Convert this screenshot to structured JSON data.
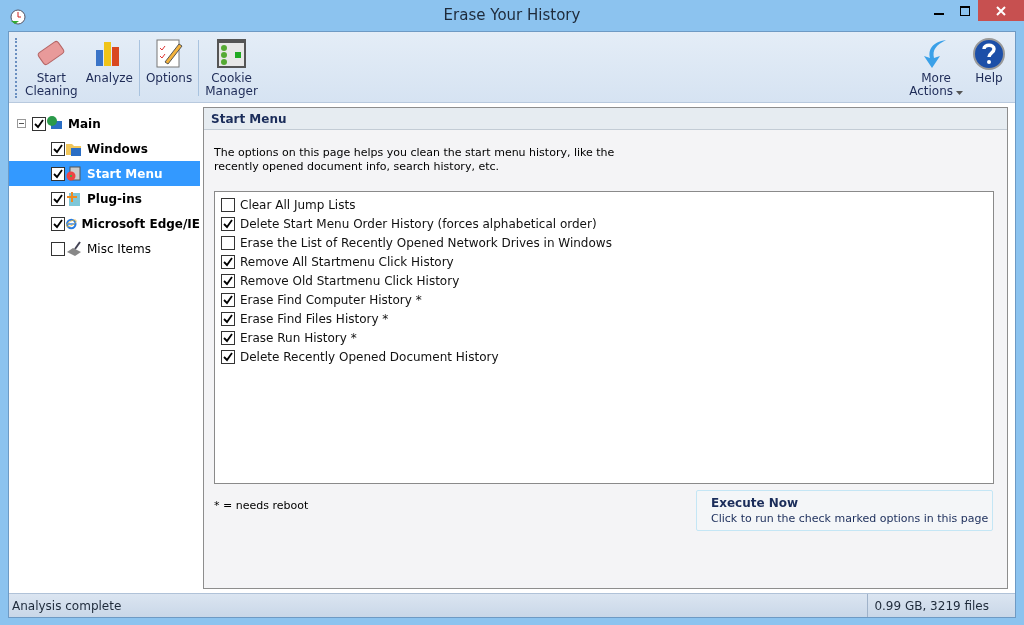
{
  "window": {
    "title": "Erase Your History"
  },
  "toolbar": {
    "groups": [
      [
        {
          "label": "Start\nCleaning"
        },
        {
          "label": "Analyze"
        }
      ],
      [
        {
          "label": "Options"
        }
      ],
      [
        {
          "label": "Cookie\nManager"
        }
      ]
    ],
    "right": [
      {
        "label": "More\nActions",
        "dropdown": true
      },
      {
        "label": "Help",
        "dropdown": false
      }
    ]
  },
  "tree": [
    {
      "label": "Main",
      "checked": true,
      "expanded": true,
      "selected": false,
      "children": [
        {
          "label": "Windows",
          "checked": true,
          "selected": false
        },
        {
          "label": "Start Menu",
          "checked": true,
          "selected": true
        },
        {
          "label": "Plug-ins",
          "checked": true,
          "selected": false
        },
        {
          "label": "Microsoft Edge/IE",
          "checked": true,
          "selected": false
        },
        {
          "label": "Misc Items",
          "checked": false,
          "selected": false
        }
      ]
    }
  ],
  "panel": {
    "title": "Start Menu",
    "description": "The options on this page helps you clean the start menu history, like the\nrecently opened document info, search history, etc.",
    "options": [
      {
        "label": "Clear All Jump Lists",
        "checked": false
      },
      {
        "label": "Delete Start Menu Order History (forces alphabetical order)",
        "checked": true
      },
      {
        "label": "Erase the List of Recently Opened Network Drives in Windows",
        "checked": false
      },
      {
        "label": "Remove All Startmenu Click History",
        "checked": true
      },
      {
        "label": "Remove Old Startmenu Click History",
        "checked": true
      },
      {
        "label": "Erase Find Computer History *",
        "checked": true
      },
      {
        "label": "Erase Find Files History *",
        "checked": true
      },
      {
        "label": "Erase Run History *",
        "checked": true
      },
      {
        "label": "Delete Recently Opened Document History",
        "checked": true
      }
    ],
    "note": "* = needs reboot",
    "execute": {
      "title": "Execute Now",
      "subtitle": "Click to run the check marked options in this page"
    }
  },
  "status_bar": {
    "message": "Analysis complete",
    "summary": "0.99 GB, 3219 files"
  }
}
